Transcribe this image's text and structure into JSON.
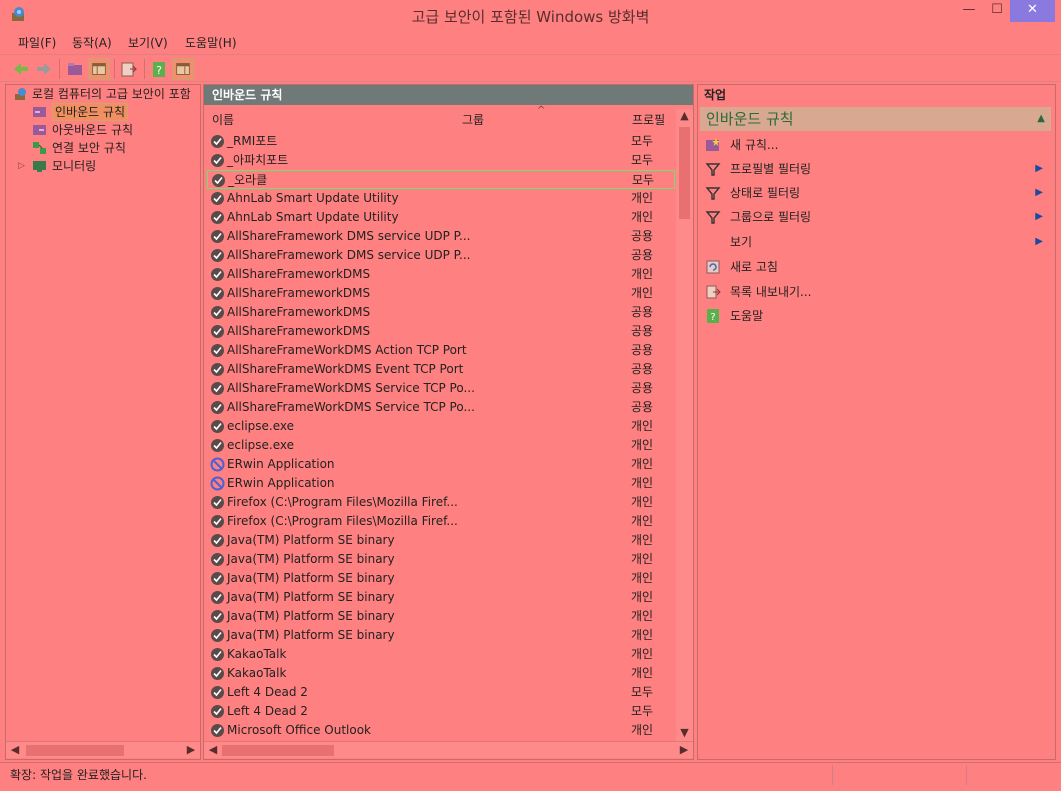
{
  "window": {
    "title": "고급 보안이 포함된 Windows 방화벽",
    "minimize": "—",
    "maximize": "☐",
    "close": "✕"
  },
  "menu": [
    "파일(F)",
    "동작(A)",
    "보기(V)",
    "도움말(H)"
  ],
  "toolbar": {
    "icons": [
      "back-arrow-icon",
      "forward-arrow-icon",
      "folder-up-icon",
      "show-hide-console-tree-icon",
      "export-list-icon",
      "help-icon",
      "show-hide-action-pane-icon"
    ]
  },
  "tree": {
    "root": "로컬 컴퓨터의 고급 보안이 포함",
    "items": [
      {
        "label": "인바운드 규칙",
        "selected": true
      },
      {
        "label": "아웃바운드 규칙",
        "selected": false
      },
      {
        "label": "연결 보안 규칙",
        "selected": false
      },
      {
        "label": "모니터링",
        "selected": false,
        "expander": "▷"
      }
    ]
  },
  "center": {
    "header": "인바운드 규칙",
    "columns": {
      "name": "이름",
      "group": "그룹",
      "profile": "프로필"
    },
    "sort_indicator": "^",
    "rules": [
      {
        "name": "_RMI포트",
        "profile": "모두",
        "icon": "allow"
      },
      {
        "name": "_아파치포트",
        "profile": "모두",
        "icon": "allow"
      },
      {
        "name": "_오라클",
        "profile": "모두",
        "icon": "allow"
      },
      {
        "name": "AhnLab Smart Update Utility",
        "profile": "개인",
        "icon": "allow"
      },
      {
        "name": "AhnLab Smart Update Utility",
        "profile": "개인",
        "icon": "allow"
      },
      {
        "name": "AllShareFramework DMS service UDP P...",
        "profile": "공용",
        "icon": "allow"
      },
      {
        "name": "AllShareFramework DMS service UDP P...",
        "profile": "공용",
        "icon": "allow"
      },
      {
        "name": "AllShareFrameworkDMS",
        "profile": "개인",
        "icon": "allow"
      },
      {
        "name": "AllShareFrameworkDMS",
        "profile": "개인",
        "icon": "allow"
      },
      {
        "name": "AllShareFrameworkDMS",
        "profile": "공용",
        "icon": "allow"
      },
      {
        "name": "AllShareFrameworkDMS",
        "profile": "공용",
        "icon": "allow"
      },
      {
        "name": "AllShareFrameWorkDMS Action TCP Port",
        "profile": "공용",
        "icon": "allow"
      },
      {
        "name": "AllShareFrameWorkDMS Event TCP Port",
        "profile": "공용",
        "icon": "allow"
      },
      {
        "name": "AllShareFrameWorkDMS Service TCP Po...",
        "profile": "공용",
        "icon": "allow"
      },
      {
        "name": "AllShareFrameWorkDMS Service TCP Po...",
        "profile": "공용",
        "icon": "allow"
      },
      {
        "name": "eclipse.exe",
        "profile": "개인",
        "icon": "allow"
      },
      {
        "name": "eclipse.exe",
        "profile": "개인",
        "icon": "allow"
      },
      {
        "name": "ERwin Application",
        "profile": "개인",
        "icon": "block"
      },
      {
        "name": "ERwin Application",
        "profile": "개인",
        "icon": "block"
      },
      {
        "name": "Firefox (C:\\Program Files\\Mozilla Firef...",
        "profile": "개인",
        "icon": "allow"
      },
      {
        "name": "Firefox (C:\\Program Files\\Mozilla Firef...",
        "profile": "개인",
        "icon": "allow"
      },
      {
        "name": "Java(TM) Platform SE binary",
        "profile": "개인",
        "icon": "allow"
      },
      {
        "name": "Java(TM) Platform SE binary",
        "profile": "개인",
        "icon": "allow"
      },
      {
        "name": "Java(TM) Platform SE binary",
        "profile": "개인",
        "icon": "allow"
      },
      {
        "name": "Java(TM) Platform SE binary",
        "profile": "개인",
        "icon": "allow"
      },
      {
        "name": "Java(TM) Platform SE binary",
        "profile": "개인",
        "icon": "allow"
      },
      {
        "name": "Java(TM) Platform SE binary",
        "profile": "개인",
        "icon": "allow"
      },
      {
        "name": "KakaoTalk",
        "profile": "개인",
        "icon": "allow"
      },
      {
        "name": "KakaoTalk",
        "profile": "개인",
        "icon": "allow"
      },
      {
        "name": "Left 4 Dead 2",
        "profile": "모두",
        "icon": "allow"
      },
      {
        "name": "Left 4 Dead 2",
        "profile": "모두",
        "icon": "allow"
      },
      {
        "name": "Microsoft Office Outlook",
        "profile": "개인",
        "icon": "allow"
      }
    ]
  },
  "actions": {
    "header": "작업",
    "group": "인바운드 규칙",
    "group_toggle": "▲",
    "items": [
      {
        "label": "새 규칙...",
        "icon": "new-rule-icon",
        "submenu": false
      },
      {
        "label": "프로필별 필터링",
        "icon": "filter-icon",
        "submenu": true
      },
      {
        "label": "상태로 필터링",
        "icon": "filter-icon",
        "submenu": true
      },
      {
        "label": "그룹으로 필터링",
        "icon": "filter-icon",
        "submenu": true
      },
      {
        "label": "보기",
        "icon": "",
        "submenu": true
      },
      {
        "label": "새로 고침",
        "icon": "refresh-icon",
        "submenu": false
      },
      {
        "label": "목록 내보내기...",
        "icon": "export-icon",
        "submenu": false
      },
      {
        "label": "도움말",
        "icon": "help-icon",
        "submenu": false
      }
    ],
    "submenu_arrow": "▶"
  },
  "status": {
    "text": "확장:  작업을 완료했습니다."
  },
  "colors": {
    "allow_icon": "#5a4a4a",
    "block_icon": "#5060d0",
    "header_bg": "#6f7a78",
    "close_button": "#8a7ae0",
    "focus_border": "#70e070"
  }
}
